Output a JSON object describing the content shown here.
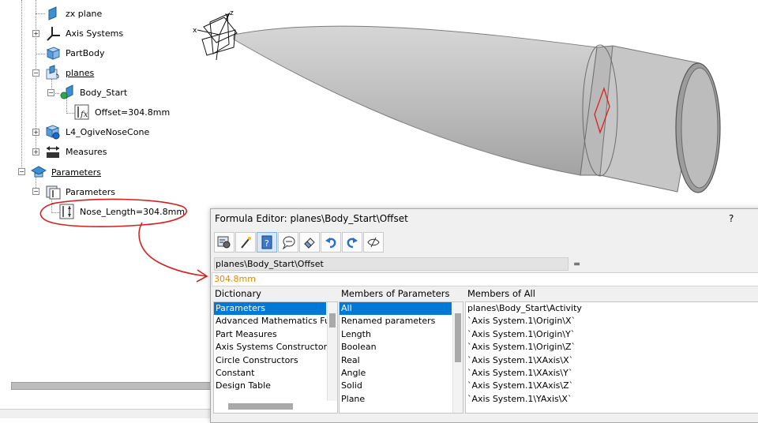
{
  "tree": {
    "items": [
      {
        "label": "zx plane",
        "icon": "plane-icon"
      },
      {
        "label": "Axis Systems",
        "icon": "axis-system-icon"
      },
      {
        "label": "PartBody",
        "icon": "part-body-icon"
      },
      {
        "label": "planes",
        "icon": "geometrical-set-icon"
      },
      {
        "label": "Body_Start",
        "icon": "plane-icon"
      },
      {
        "label": "Offset=304.8mm",
        "icon": "formula-parameter-icon"
      },
      {
        "label": "L4_OgiveNoseCone",
        "icon": "body-icon"
      },
      {
        "label": "Measures",
        "icon": "measure-icon"
      },
      {
        "label": "Parameters",
        "icon": "parameters-icon"
      },
      {
        "label": "Parameters",
        "icon": "parameter-set-icon"
      },
      {
        "label": "Nose_Length=304.8mm",
        "icon": "length-parameter-icon"
      }
    ]
  },
  "viewport": {
    "axis_labels": {
      "x": "x",
      "y": "y",
      "z": "z"
    },
    "model": "ogive nose cone",
    "highlight_color": "#e02020"
  },
  "annotation": {
    "color": "#d42020",
    "description": "red circle around Nose_Length parameter with arrow to formula field"
  },
  "formula_editor": {
    "title": "Formula Editor: planes\\Body_Start\\Offset",
    "help": "?",
    "toolbar": [
      {
        "name": "import-formula-icon"
      },
      {
        "name": "magic-wand-icon"
      },
      {
        "name": "help-icon"
      },
      {
        "name": "measure-speech-icon"
      },
      {
        "name": "eraser-icon"
      },
      {
        "name": "undo-icon"
      },
      {
        "name": "redo-icon"
      },
      {
        "name": "show-hide-icon"
      }
    ],
    "parameter_name": "planes\\Body_Start\\Offset",
    "equals": "=",
    "formula_value": "304.8mm",
    "dictionary": {
      "header": "Dictionary",
      "items": [
        "Parameters",
        "Advanced Mathematics Fu",
        "Part Measures",
        "Axis Systems Constructors",
        "Circle Constructors",
        "Constant",
        "Design Table"
      ],
      "selected_index": 0
    },
    "members_of_parameters": {
      "header": "Members of Parameters",
      "items": [
        "All",
        "Renamed parameters",
        "Length",
        "Boolean",
        "Real",
        "Angle",
        "Solid",
        "Plane"
      ],
      "selected_index": 0
    },
    "members_of_all": {
      "header": "Members of All",
      "items": [
        "planes\\Body_Start\\Activity",
        "`Axis System.1\\Origin\\X`",
        "`Axis System.1\\Origin\\Y`",
        "`Axis System.1\\Origin\\Z`",
        "`Axis System.1\\XAxis\\X`",
        "`Axis System.1\\XAxis\\Y`",
        "`Axis System.1\\XAxis\\Z`",
        "`Axis System.1\\YAxis\\X`"
      ]
    }
  }
}
